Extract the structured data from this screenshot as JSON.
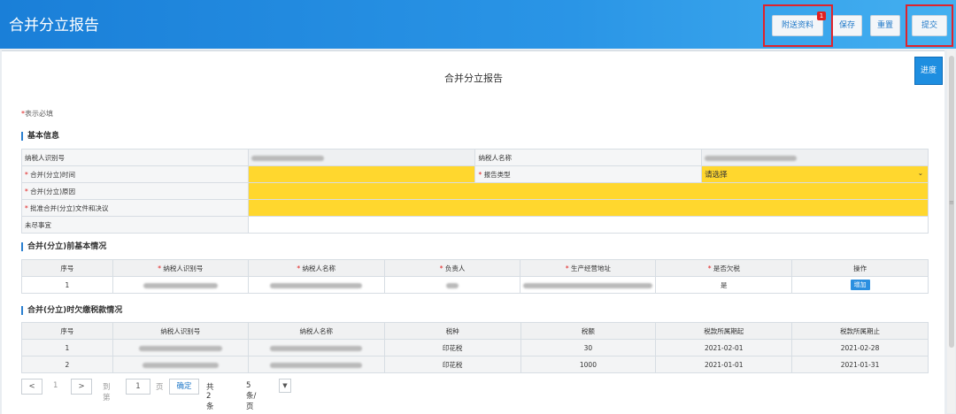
{
  "header": {
    "title": "合并分立报告",
    "buttons": {
      "attach": "附送资料",
      "attach_badge": "1",
      "save": "保存",
      "reset": "重置",
      "submit": "提交"
    }
  },
  "page_title": "合并分立报告",
  "progress_button": "进度",
  "required_note": {
    "star": "*",
    "text": "表示必填"
  },
  "basic": {
    "section": "基本信息",
    "taxpayer_id_label": "纳税人识别号",
    "taxpayer_name_label": "纳税人名称",
    "merge_time_label": "合并(分立)时间",
    "report_type_label": "报告类型",
    "report_type_value": "请选择",
    "reason_label": "合并(分立)原因",
    "approve_label": "批准合并(分立)文件和决议",
    "pending_label": "未尽事宜"
  },
  "before": {
    "section": "合并(分立)前基本情况",
    "headers": [
      "序号",
      "纳税人识别号",
      "纳税人名称",
      "负责人",
      "生产经营地址",
      "是否欠税",
      "操作"
    ],
    "required": [
      false,
      true,
      true,
      true,
      true,
      true,
      false
    ],
    "rows": [
      {
        "no": "1",
        "owe": "是",
        "action": "增加"
      }
    ]
  },
  "arrears": {
    "section": "合并(分立)时欠缴税款情况",
    "headers": [
      "序号",
      "纳税人识别号",
      "纳税人名称",
      "税种",
      "税额",
      "税款所属期起",
      "税款所属期止"
    ],
    "rows": [
      {
        "no": "1",
        "tax": "印花税",
        "amount": "30",
        "start": "2021-02-01",
        "end": "2021-02-28"
      },
      {
        "no": "2",
        "tax": "印花税",
        "amount": "1000",
        "start": "2021-01-01",
        "end": "2021-01-31"
      }
    ]
  },
  "pager": {
    "prev": "<",
    "current": "1",
    "next": ">",
    "goto": "到第",
    "page_input": "1",
    "page_unit": "页",
    "confirm": "确定",
    "total": "共 2 条",
    "per_page": "5 条/页",
    "dropdown": "▼"
  },
  "colors": {
    "header": "#2a8fe0",
    "required_fill": "#ffd72e",
    "highlight": "#e0232b"
  }
}
